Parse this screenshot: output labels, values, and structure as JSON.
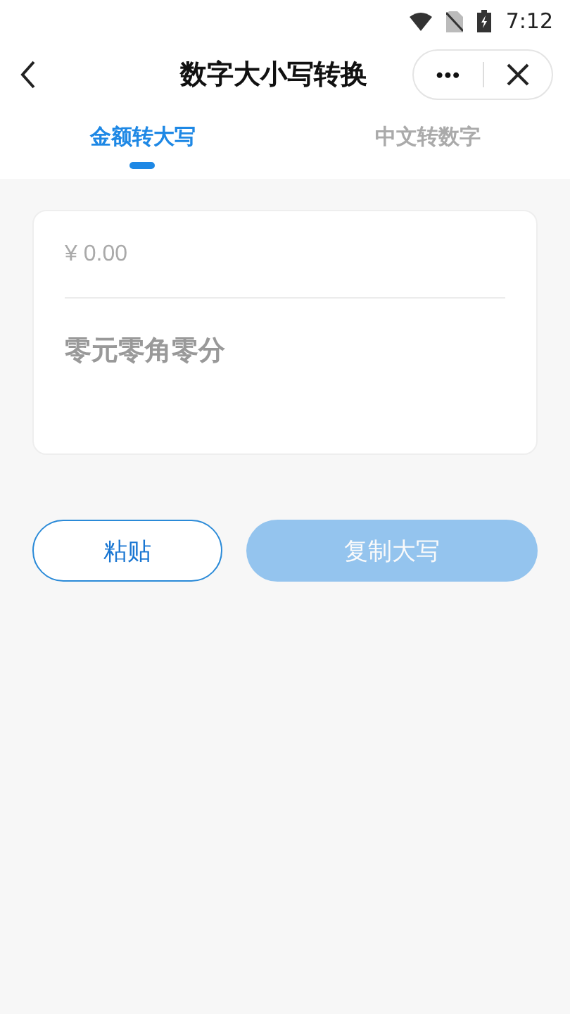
{
  "status_bar": {
    "time": "7:12"
  },
  "nav": {
    "title": "数字大小写转换",
    "menu": "•••"
  },
  "tabs": [
    {
      "label": "金额转大写",
      "selected": true
    },
    {
      "label": "中文转数字",
      "selected": false
    }
  ],
  "amount_field": {
    "placeholder": "¥ 0.00"
  },
  "result": "零元零角零分",
  "buttons": [
    {
      "label": "粘贴",
      "kind": "outline",
      "disabled": false
    },
    {
      "label": "复制大写",
      "kind": "filled",
      "disabled": true
    }
  ]
}
